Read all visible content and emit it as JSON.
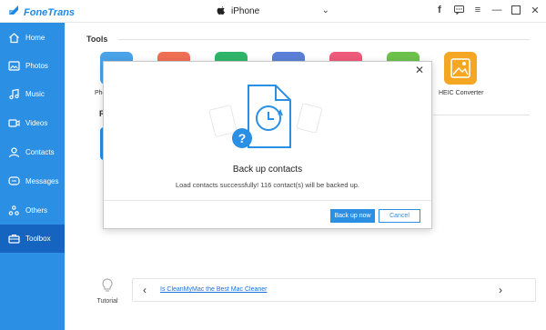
{
  "app": {
    "name": "FoneTrans",
    "brand_color": "#1e88e5",
    "sidebar_color": "#2b8fe4",
    "sidebar_active_color": "#1565c0"
  },
  "device": {
    "name": "iPhone"
  },
  "window_controls": [
    {
      "name": "facebook-icon",
      "glyph": "f"
    },
    {
      "name": "chat-icon",
      "glyph": "▣"
    },
    {
      "name": "menu-icon",
      "glyph": "≡"
    },
    {
      "name": "minimize-icon",
      "glyph": "—"
    },
    {
      "name": "maximize-icon",
      "glyph": "☐"
    },
    {
      "name": "close-icon",
      "glyph": "✕"
    }
  ],
  "sidebar": {
    "items": [
      {
        "label": "Home",
        "icon": "home-icon"
      },
      {
        "label": "Photos",
        "icon": "photos-icon"
      },
      {
        "label": "Music",
        "icon": "music-icon"
      },
      {
        "label": "Videos",
        "icon": "videos-icon"
      },
      {
        "label": "Contacts",
        "icon": "contacts-icon"
      },
      {
        "label": "Messages",
        "icon": "messages-icon"
      },
      {
        "label": "Others",
        "icon": "others-icon"
      },
      {
        "label": "Toolbox",
        "icon": "toolbox-icon",
        "active": true
      }
    ]
  },
  "main": {
    "tools_heading": "Tools",
    "tools": [
      {
        "label": "Pho",
        "color": "#4aa3e8"
      },
      {
        "label": "",
        "color": "#ef6f55"
      },
      {
        "label": "",
        "color": "#2fb56a"
      },
      {
        "label": "",
        "color": "#5b7fd6"
      },
      {
        "label": "",
        "color": "#ee5a7a"
      },
      {
        "label": "",
        "color": "#6dc24b"
      },
      {
        "label": "HEIC Converter",
        "color": "#f5a623"
      }
    ],
    "second_heading": "R"
  },
  "dialog": {
    "title": "Back up contacts",
    "message": "Load contacts successfully! 116 contact(s) will be backed up.",
    "primary_button": "Back up now",
    "secondary_button": "Cancel"
  },
  "tutorial": {
    "label": "Tutorial",
    "banner_link": "Is CleanMyMac the Best Mac Cleaner"
  }
}
